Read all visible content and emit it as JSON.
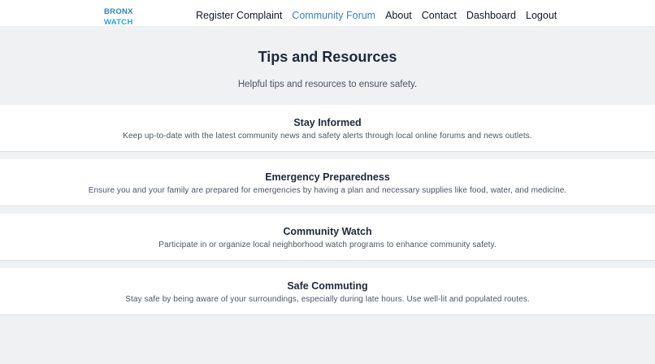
{
  "brand": {
    "line1": "BRONX",
    "line2": "WATCH"
  },
  "nav": [
    {
      "label": "Register Complaint",
      "active": false
    },
    {
      "label": "Community Forum",
      "active": true
    },
    {
      "label": "About",
      "active": false
    },
    {
      "label": "Contact",
      "active": false
    },
    {
      "label": "Dashboard",
      "active": false
    },
    {
      "label": "Logout",
      "active": false
    }
  ],
  "hero": {
    "title": "Tips and Resources",
    "subtitle": "Helpful tips and resources to ensure safety."
  },
  "tips": [
    {
      "title": "Stay Informed",
      "text": "Keep up-to-date with the latest community news and safety alerts through local online forums and news outlets."
    },
    {
      "title": "Emergency Preparedness",
      "text": "Ensure you and your family are prepared for emergencies by having a plan and necessary supplies like food, water, and medicine."
    },
    {
      "title": "Community Watch",
      "text": "Participate in or organize local neighborhood watch programs to enhance community safety."
    },
    {
      "title": "Safe Commuting",
      "text": "Stay safe by being aware of your surroundings, especially during late hours. Use well-lit and populated routes."
    }
  ],
  "colors": {
    "accent": "#3b82c4",
    "brand_dark": "#2f7fc4",
    "brand_light": "#2aa6df",
    "page_bg": "#f0f1f3"
  }
}
